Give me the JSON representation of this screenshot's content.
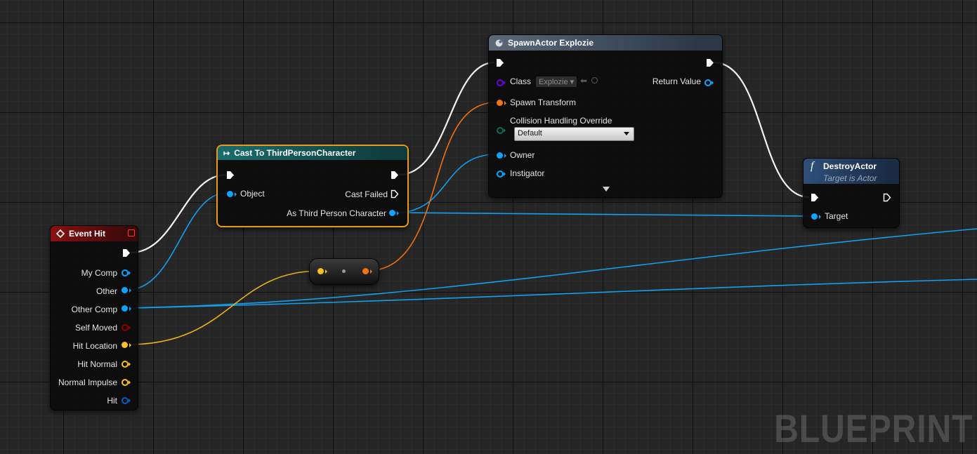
{
  "watermark": "BLUEPRINT",
  "colors": {
    "exec": "#ffffff",
    "object": "#0ba5ff",
    "vector": "#f8c023",
    "transform": "#f77413",
    "class": "#6b00d8",
    "enum": "#0a6b5a",
    "bool": "#8a0000",
    "struct": "#0a5ac0"
  },
  "event_hit": {
    "title": "Event Hit",
    "pins": [
      "My Comp",
      "Other",
      "Other Comp",
      "Self Moved",
      "Hit Location",
      "Hit Normal",
      "Normal Impulse",
      "Hit"
    ]
  },
  "cast": {
    "title": "Cast To ThirdPersonCharacter",
    "object_label": "Object",
    "cast_failed_label": "Cast Failed",
    "as_label": "As Third Person Character"
  },
  "spawn": {
    "title": "SpawnActor Explozie",
    "class_label": "Class",
    "class_value": "Explozie",
    "return_label": "Return Value",
    "transform_label": "Spawn Transform",
    "collision_label": "Collision Handling Override",
    "collision_value": "Default",
    "owner_label": "Owner",
    "instigator_label": "Instigator"
  },
  "destroy": {
    "title": "DestroyActor",
    "subtitle": "Target is Actor",
    "target_label": "Target"
  }
}
